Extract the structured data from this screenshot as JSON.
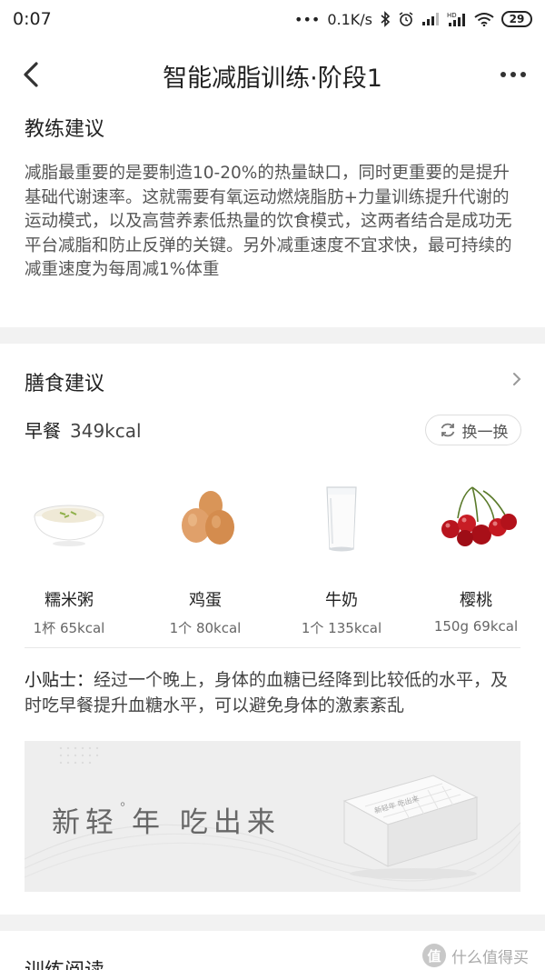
{
  "status_bar": {
    "time": "0:07",
    "network_speed": "0.1K/s",
    "battery": "29",
    "dots": "•••"
  },
  "header": {
    "title": "智能减脂训练·阶段1",
    "back_icon": "chevron-left-icon",
    "more_icon": "more-horizontal-icon"
  },
  "coach": {
    "title": "教练建议",
    "text": "减脂最重要的是要制造10-20%的热量缺口，同时更重要的是提升基础代谢速率。这就需要有氧运动燃烧脂肪+力量训练提升代谢的运动模式，以及高营养素低热量的饮食模式，这两者结合是成功无平台减脂和防止反弹的关键。另外减重速度不宜求快，最可持续的减重速度为每周减1%体重"
  },
  "diet": {
    "title": "膳食建议",
    "meal_name": "早餐",
    "meal_kcal": "349kcal",
    "swap_label": "换一换",
    "foods": [
      {
        "name": "糯米粥",
        "amount": "1杯 65kcal",
        "icon": "porridge-bowl-icon"
      },
      {
        "name": "鸡蛋",
        "amount": "1个 80kcal",
        "icon": "eggs-icon"
      },
      {
        "name": "牛奶",
        "amount": "1个 135kcal",
        "icon": "milk-glass-icon"
      },
      {
        "name": "樱桃",
        "amount": "150g 69kcal",
        "icon": "cherries-icon"
      }
    ],
    "tip_label": "小贴士：",
    "tip_text": "经过一个晚上，身体的血糖已经降到比较低的水平，及时吃早餐提升血糖水平，可以避免身体的激素紊乱"
  },
  "banner": {
    "text_a": "新轻",
    "degree": "°",
    "text_b": "年 吃出来",
    "box_label": "新轻年 吃出来"
  },
  "training": {
    "title": "训练阅读"
  },
  "watermark": {
    "badge": "值",
    "text": "什么值得买"
  }
}
